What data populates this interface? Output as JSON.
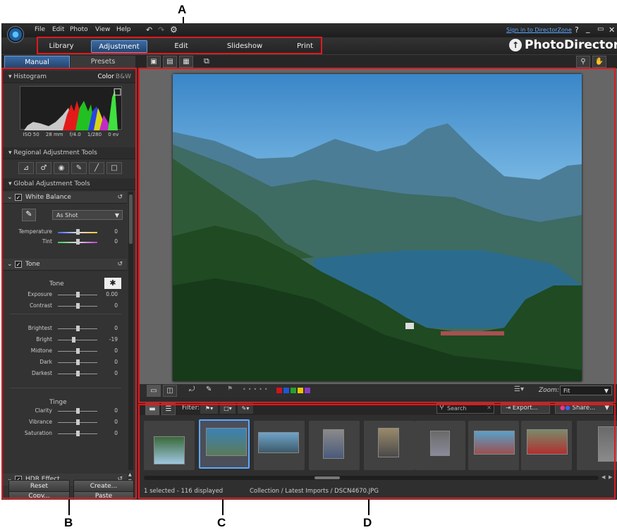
{
  "callouts": {
    "a": "A",
    "b": "B",
    "c": "C",
    "d": "D"
  },
  "menu": [
    "File",
    "Edit",
    "Photo",
    "View",
    "Help"
  ],
  "sign_in": "Sign in to DirectorZone",
  "window_controls": {
    "help": "?",
    "minimize": "_",
    "restore": "▭",
    "close": "✕"
  },
  "brand": "PhotoDirector",
  "tabs": [
    {
      "label": "Library"
    },
    {
      "label": "Adjustment",
      "active": true
    },
    {
      "label": "Edit"
    },
    {
      "label": "Slideshow"
    },
    {
      "label": "Print"
    }
  ],
  "panel_tabs": {
    "manual": "Manual",
    "presets": "Presets"
  },
  "histogram": {
    "title": "Histogram",
    "color": "Color",
    "bw": "B&W",
    "info": [
      "ISO 50",
      "28 mm",
      "f/4.0",
      "1/280",
      "0 ev"
    ]
  },
  "regional": {
    "title": "Regional Adjustment Tools"
  },
  "global": {
    "title": "Global Adjustment Tools"
  },
  "white_balance": {
    "title": "White Balance",
    "preset": "As Shot",
    "sliders": [
      {
        "label": "Temperature",
        "value": "0",
        "pos": 0.5
      },
      {
        "label": "Tint",
        "value": "0",
        "pos": 0.5
      }
    ]
  },
  "tone": {
    "title": "Tone",
    "sub": "Tone",
    "sliders_a": [
      {
        "label": "Exposure",
        "value": "0.00",
        "pos": 0.5
      },
      {
        "label": "Contrast",
        "value": "0",
        "pos": 0.5
      }
    ],
    "sliders_b": [
      {
        "label": "Brightest",
        "value": "0",
        "pos": 0.5
      },
      {
        "label": "Bright",
        "value": "-19",
        "pos": 0.4
      },
      {
        "label": "Midtone",
        "value": "0",
        "pos": 0.5
      },
      {
        "label": "Dark",
        "value": "0",
        "pos": 0.5
      },
      {
        "label": "Darkest",
        "value": "0",
        "pos": 0.5
      }
    ],
    "tinge": "Tinge",
    "sliders_c": [
      {
        "label": "Clarity",
        "value": "0",
        "pos": 0.5
      },
      {
        "label": "Vibrance",
        "value": "0",
        "pos": 0.5
      },
      {
        "label": "Saturation",
        "value": "0",
        "pos": 0.5
      }
    ]
  },
  "hdr": {
    "title": "HDR Effect"
  },
  "bottom_buttons": {
    "copy": "Copy...",
    "paste": "Paste",
    "reset": "Reset",
    "create": "Create..."
  },
  "view_toolbar": {
    "zoom_label": "Zoom:",
    "zoom_value": "Fit",
    "labels": [
      "#d0141c",
      "#1a58d4",
      "#2a9e2a",
      "#e8c20c",
      "#8a3ac0"
    ]
  },
  "filmstrip": {
    "filter_label": "Filter:",
    "search_placeholder": "Search",
    "export": "Export...",
    "share": "Share...",
    "status": "1 selected - 116 displayed",
    "path": "Collection / Latest Imports / DSCN4670.JPG"
  }
}
